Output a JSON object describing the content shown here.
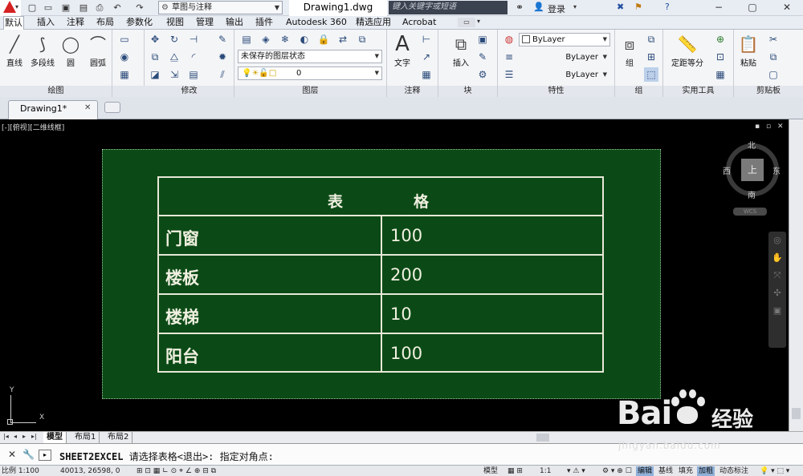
{
  "titlebar": {
    "workspace": "草图与注释",
    "doc_title": "Drawing1.dwg",
    "search_placeholder": "键入关键字或短语",
    "login": "登录"
  },
  "ribbon_tabs": [
    "默认",
    "插入",
    "注释",
    "布局",
    "参数化",
    "视图",
    "管理",
    "输出",
    "插件",
    "Autodesk 360",
    "精选应用",
    "Acrobat"
  ],
  "panels": {
    "draw": {
      "title": "绘图",
      "line": "直线",
      "polyline": "多段线",
      "circle": "圆",
      "arc": "圆弧"
    },
    "modify": {
      "title": "修改"
    },
    "layers": {
      "title": "图层",
      "layer_state": "未保存的图层状态",
      "current_layer": "0"
    },
    "annotation": {
      "title": "注释",
      "text": "文字"
    },
    "block": {
      "title": "块",
      "insert": "插入"
    },
    "properties": {
      "title": "特性",
      "color": "ByLayer",
      "linetype": "ByLayer",
      "lineweight": "ByLayer"
    },
    "groups": {
      "title": "组",
      "group": "组"
    },
    "utilities": {
      "title": "实用工具",
      "measure": "定距等分"
    },
    "clipboard": {
      "title": "剪贴板",
      "paste": "粘贴"
    }
  },
  "file_tabs": {
    "active": "Drawing1*"
  },
  "viewport": {
    "label": "[-][俯视][二维线框]",
    "compass": {
      "n": "北",
      "s": "南",
      "e": "东",
      "w": "西",
      "face": "上"
    },
    "wcs": "WCS",
    "ucs_x": "X",
    "ucs_y": "Y"
  },
  "table": {
    "header": "表格",
    "rows": [
      {
        "name": "门窗",
        "value": "100"
      },
      {
        "name": "楼板",
        "value": "200"
      },
      {
        "name": "楼梯",
        "value": "10"
      },
      {
        "name": "阳台",
        "value": "100"
      }
    ]
  },
  "layout_tabs": [
    "模型",
    "布局1",
    "布局2"
  ],
  "command_line": {
    "command": "SHEET2EXCEL",
    "prompt": "请选择表格<退出>: 指定对角点:"
  },
  "statusbar": {
    "scale": "比例 1:100",
    "coords": "40013, 26598, 0",
    "model": "模型",
    "anno_scale": "1:1",
    "buttons": [
      "编辑",
      "基线",
      "填充",
      "加粗",
      "动态标注"
    ]
  },
  "watermark": {
    "brand": "Bai",
    "brand2": "经验",
    "url": "jingyan.baidu.com"
  },
  "colors": {
    "sheet_bg": "#0b4a16",
    "table_line": "#e8e8d8",
    "app_red": "#d52222"
  }
}
